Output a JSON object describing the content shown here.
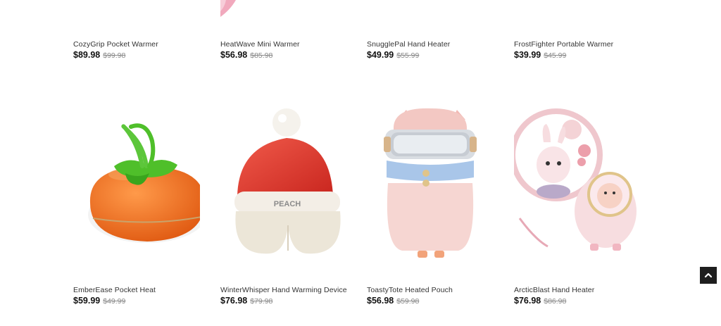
{
  "products": [
    {
      "name": "CozyGrip Pocket Warmer",
      "price": "$89.98",
      "old_price": "$99.98"
    },
    {
      "name": "HeatWave Mini Warmer",
      "price": "$56.98",
      "old_price": "$85.98"
    },
    {
      "name": "SnugglePal Hand Heater",
      "price": "$49.99",
      "old_price": "$55.99"
    },
    {
      "name": "FrostFighter Portable Warmer",
      "price": "$39.99",
      "old_price": "$45.99"
    },
    {
      "name": "EmberEase Pocket Heat",
      "price": "$59.99",
      "old_price": "$49.99"
    },
    {
      "name": "WinterWhisper Hand Warming Device",
      "price": "$76.98",
      "old_price": "$79.98"
    },
    {
      "name": "ToastyTote Heated Pouch",
      "price": "$56.98",
      "old_price": "$59.98"
    },
    {
      "name": "ArcticBlast Hand Heater",
      "price": "$76.98",
      "old_price": "$86.98"
    }
  ],
  "hat_label": "PEACH",
  "back_to_top_icon": "chevron-up-icon",
  "colors": {
    "price": "#111111",
    "old_price": "#8a8a8a",
    "back_to_top_bg": "#1e1e1e"
  }
}
